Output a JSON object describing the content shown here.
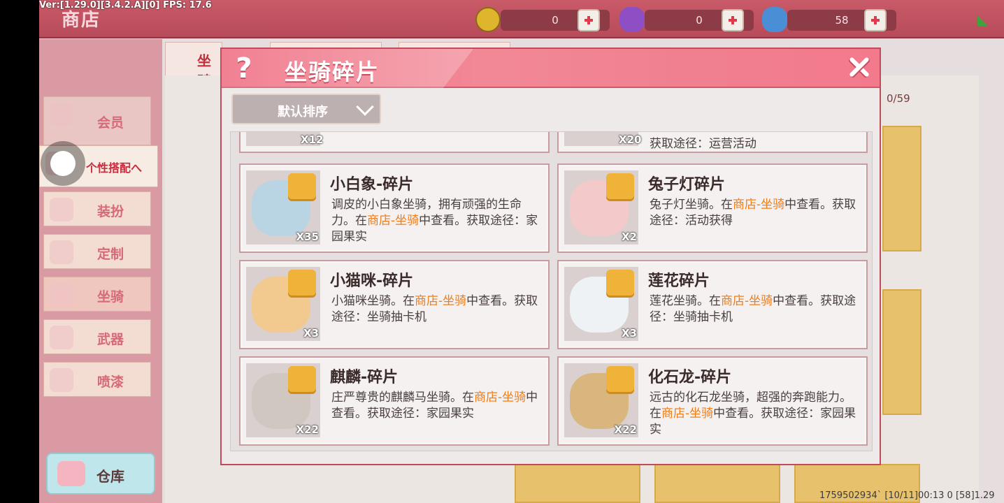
{
  "debug": {
    "version": "Ver:[1.29.0][3.4.2.A][0] FPS: 17.6",
    "footer": "1759502934` [10/11]00:13 0   [58]1.29"
  },
  "topbar": {
    "title": "商店",
    "currencies": [
      {
        "icon": "gold-coin-icon",
        "value": "0"
      },
      {
        "icon": "purple-gem-icon",
        "value": "0"
      },
      {
        "icon": "blue-gem-icon",
        "value": "58"
      }
    ]
  },
  "sidemenu": {
    "member": "会员",
    "personal": "个性搭配へ",
    "dress": "装扮",
    "custom": "定制",
    "mount": "坐骑",
    "weapon": "武器",
    "spray": "喷漆",
    "warehouse": "仓库"
  },
  "background": {
    "active_tab": "坐骑",
    "count": "0/59"
  },
  "modal": {
    "title": "坐骑碎片",
    "sort_label": "默认排序",
    "partial_items": [
      {
        "qty": "X12",
        "text": ""
      },
      {
        "qty": "X20",
        "text": "获取途径：运营活动"
      }
    ],
    "items": [
      {
        "name": "小白象-碎片",
        "qty": "X35",
        "icon": "white-elephant-icon",
        "desc_pre": "调皮的小白象坐骑，拥有顽强的生命力。在",
        "desc_hl": "商店-坐骑",
        "desc_post": "中查看。获取途径：家园果实"
      },
      {
        "name": "兔子灯碎片",
        "qty": "X2",
        "icon": "rabbit-lantern-icon",
        "desc_pre": "兔子灯坐骑。在",
        "desc_hl": "商店-坐骑",
        "desc_post": "中查看。获取途径：活动获得"
      },
      {
        "name": "小猫咪-碎片",
        "qty": "X3",
        "icon": "kitten-icon",
        "desc_pre": "小猫咪坐骑。在",
        "desc_hl": "商店-坐骑",
        "desc_post": "中查看。获取途径：坐骑抽卡机"
      },
      {
        "name": "莲花碎片",
        "qty": "X3",
        "icon": "lotus-icon",
        "desc_pre": "莲花坐骑。在",
        "desc_hl": "商店-坐骑",
        "desc_post": "中查看。获取途径：坐骑抽卡机"
      },
      {
        "name": "麒麟-碎片",
        "qty": "X22",
        "icon": "qilin-icon",
        "desc_pre": "庄严尊贵的麒麟马坐骑。在",
        "desc_hl": "商店-坐骑",
        "desc_post": "中查看。获取途径：家园果实"
      },
      {
        "name": "化石龙-碎片",
        "qty": "X22",
        "icon": "fossil-dragon-icon",
        "desc_pre": "远古的化石龙坐骑，超强的奔跑能力。在",
        "desc_hl": "商店-坐骑",
        "desc_post": "中查看。获取途径：家园果实"
      }
    ]
  },
  "colors": {
    "accent": "#f28896",
    "highlight": "#ef7d1a",
    "puzzle": "#f0b33a"
  }
}
